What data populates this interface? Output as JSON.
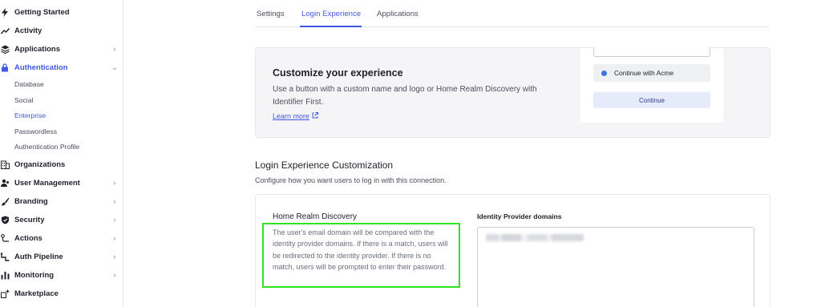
{
  "sidebar": {
    "items": [
      {
        "label": "Getting Started",
        "icon": "bolt-icon",
        "chevron": false
      },
      {
        "label": "Activity",
        "icon": "activity-chart-icon",
        "chevron": false
      },
      {
        "label": "Applications",
        "icon": "layers-icon",
        "chevron": true
      },
      {
        "label": "Authentication",
        "icon": "lock-icon",
        "chevron": true,
        "active": true,
        "expanded": true
      },
      {
        "label": "Organizations",
        "icon": "building-icon",
        "chevron": false
      },
      {
        "label": "User Management",
        "icon": "users-icon",
        "chevron": true
      },
      {
        "label": "Branding",
        "icon": "brush-icon",
        "chevron": true
      },
      {
        "label": "Security",
        "icon": "shield-check-icon",
        "chevron": true
      },
      {
        "label": "Actions",
        "icon": "actions-flow-icon",
        "chevron": true
      },
      {
        "label": "Auth Pipeline",
        "icon": "pipeline-icon",
        "chevron": true
      },
      {
        "label": "Monitoring",
        "icon": "bar-chart-icon",
        "chevron": true
      },
      {
        "label": "Marketplace",
        "icon": "sparkle-icon",
        "chevron": false
      }
    ],
    "auth_subitems": [
      "Database",
      "Social",
      "Enterprise",
      "Passwordless",
      "Authentication Profile"
    ],
    "active_subitem": "Enterprise"
  },
  "tabs": [
    {
      "label": "Settings"
    },
    {
      "label": "Login Experience",
      "active": true
    },
    {
      "label": "Applications"
    }
  ],
  "customize": {
    "title": "Customize your experience",
    "description": "Use a button with a custom name and logo or Home Realm Discovery with Identifier First.",
    "learn_more": "Learn more",
    "preview": {
      "acme_button": "Continue with Acme",
      "continue_button": "Continue"
    }
  },
  "section": {
    "title": "Login Experience Customization",
    "subtitle": "Configure how you want users to log in with this connection."
  },
  "hrd": {
    "title": "Home Realm Discovery",
    "description": "The user's email domain will be compared with the identity provider domains. If there is a match, users will be redirected to the identity provider. If there is no match, users will be prompted to enter their password.",
    "idp_label": "Identity Provider domains"
  },
  "colors": {
    "accent": "#3f59e4",
    "highlight": "#2be51f"
  }
}
